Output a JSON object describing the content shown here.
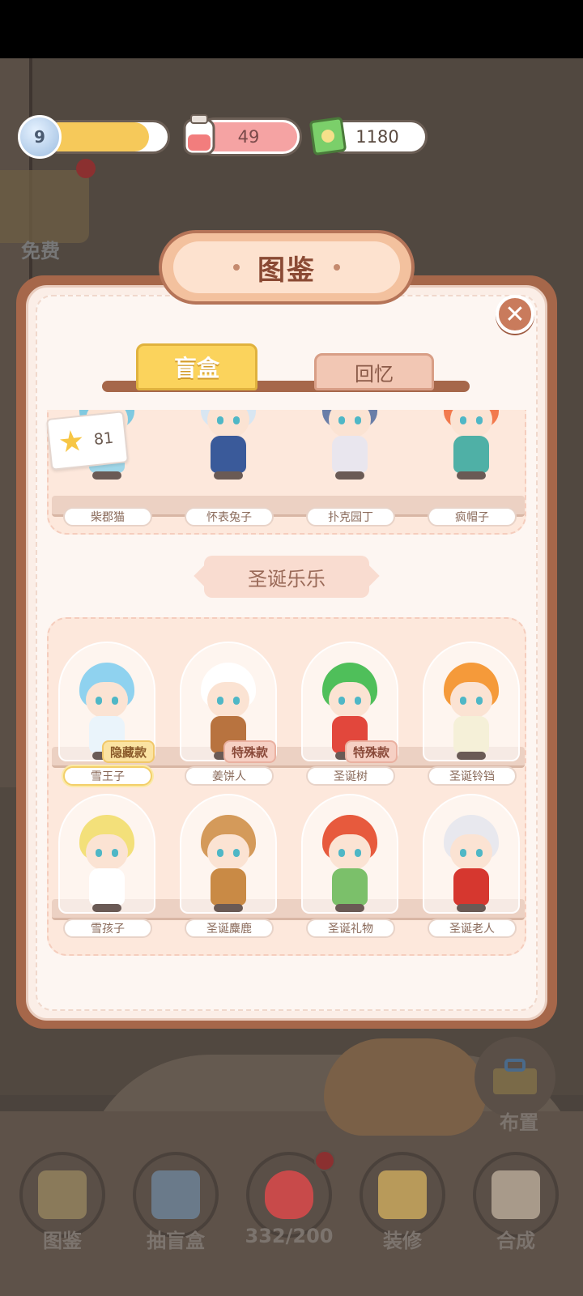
{
  "hud": {
    "level": "9",
    "level_progress": 0.85,
    "hearts": "49",
    "cash": "1180"
  },
  "side": {
    "free_label": "免费"
  },
  "modal": {
    "title": "图鉴",
    "tabs": [
      {
        "label": "盲盒",
        "active": true
      },
      {
        "label": "回忆",
        "active": false
      }
    ],
    "star_count": "81",
    "prev_group": {
      "items": [
        {
          "name": "柴郡猫",
          "hair": "#7fc9e0",
          "body": "#9fd6e8"
        },
        {
          "name": "怀表兔子",
          "hair": "#d8e6f2",
          "body": "#3a5a9a"
        },
        {
          "name": "扑克园丁",
          "hair": "#6a7ea8",
          "body": "#e9e6ee"
        },
        {
          "name": "疯帽子",
          "hair": "#f27a4e",
          "body": "#4fb0a6"
        }
      ]
    },
    "section_title": "圣诞乐乐",
    "christmas_items": [
      {
        "name": "雪王子",
        "badge": "隐藏款",
        "hair": "#8fd2ef",
        "body": "#eaf4fb",
        "selected": true
      },
      {
        "name": "姜饼人",
        "badge": "特殊款",
        "hair": "#ffffff",
        "body": "#b8733f",
        "selected": false
      },
      {
        "name": "圣诞树",
        "badge": "特殊款",
        "hair": "#4fbf5a",
        "body": "#e2473c",
        "selected": false
      },
      {
        "name": "圣诞铃铛",
        "badge": "",
        "hair": "#f59a3a",
        "body": "#f5f0d8",
        "selected": false
      },
      {
        "name": "雪孩子",
        "badge": "",
        "hair": "#f3e07a",
        "body": "#ffffff",
        "selected": false
      },
      {
        "name": "圣诞麋鹿",
        "badge": "",
        "hair": "#d49a5a",
        "body": "#c98a45",
        "selected": false
      },
      {
        "name": "圣诞礼物",
        "badge": "",
        "hair": "#e75a3d",
        "body": "#7bc06a",
        "selected": false
      },
      {
        "name": "圣诞老人",
        "badge": "",
        "hair": "#e8e8ee",
        "body": "#d6372f",
        "selected": false
      }
    ]
  },
  "bottom_nav": [
    {
      "label": "图鉴",
      "icon": "book-icon"
    },
    {
      "label": "抽盲盒",
      "icon": "blindbox-machine-icon"
    },
    {
      "label": "332/200",
      "icon": "heart-icon"
    },
    {
      "label": "装修",
      "icon": "paint-roller-icon"
    },
    {
      "label": "合成",
      "icon": "clipboard-icon"
    }
  ],
  "layout_button": {
    "label": "布置"
  }
}
